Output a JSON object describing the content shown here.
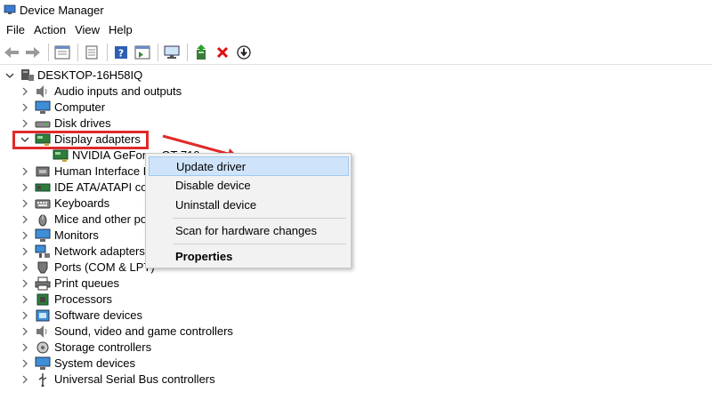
{
  "window": {
    "title": "Device Manager"
  },
  "menu": [
    "File",
    "Action",
    "View",
    "Help"
  ],
  "toolbar": {
    "buttons": [
      "back-icon",
      "forward-icon",
      "properties-pane-icon",
      "show-hidden-icon",
      "help-icon",
      "action-pane-icon",
      "monitor-scan-icon",
      "update-driver-icon",
      "uninstall-icon",
      "download-icon"
    ]
  },
  "tree": {
    "root": "DESKTOP-16H58IQ",
    "items": [
      {
        "label": "Audio inputs and outputs",
        "icon": "speaker-icon"
      },
      {
        "label": "Computer",
        "icon": "computer-icon"
      },
      {
        "label": "Disk drives",
        "icon": "disk-icon"
      },
      {
        "label": "Display adapters",
        "icon": "display-adapter-icon",
        "expanded": true
      },
      {
        "label": "NVIDIA GeForce GT 710",
        "icon": "gpu-icon",
        "child": true
      },
      {
        "label": "Human Interface Devices",
        "icon": "hid-icon"
      },
      {
        "label": "IDE ATA/ATAPI controllers",
        "icon": "ide-icon"
      },
      {
        "label": "Keyboards",
        "icon": "keyboard-icon"
      },
      {
        "label": "Mice and other pointing devices",
        "icon": "mouse-icon"
      },
      {
        "label": "Monitors",
        "icon": "monitor-icon"
      },
      {
        "label": "Network adapters",
        "icon": "network-icon"
      },
      {
        "label": "Ports (COM & LPT)",
        "icon": "port-icon"
      },
      {
        "label": "Print queues",
        "icon": "printer-icon"
      },
      {
        "label": "Processors",
        "icon": "cpu-icon"
      },
      {
        "label": "Software devices",
        "icon": "software-icon"
      },
      {
        "label": "Sound, video and game controllers",
        "icon": "sound-icon"
      },
      {
        "label": "Storage controllers",
        "icon": "storage-icon"
      },
      {
        "label": "System devices",
        "icon": "system-icon"
      },
      {
        "label": "Universal Serial Bus controllers",
        "icon": "usb-icon"
      }
    ]
  },
  "context_menu": {
    "items": [
      "Update driver",
      "Disable device",
      "Uninstall device",
      "Scan for hardware changes",
      "Properties"
    ],
    "highlighted": "Update driver"
  },
  "colors": {
    "annotation": "#e02a2a",
    "menu_highlight": "#cfe4fa"
  }
}
